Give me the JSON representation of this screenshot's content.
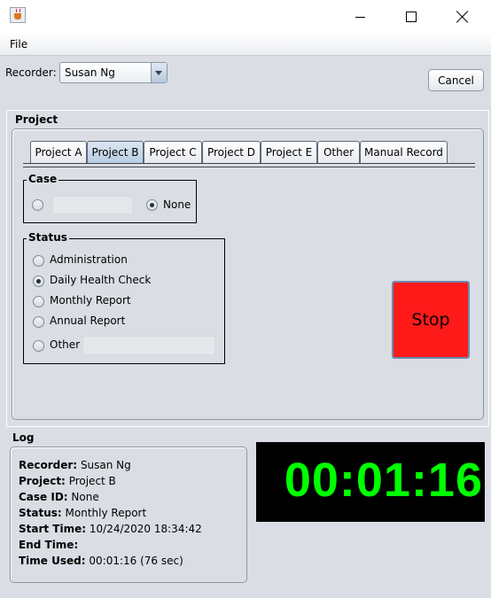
{
  "menu": {
    "file": "File"
  },
  "recorder": {
    "label": "Recorder:",
    "value": "Susan Ng"
  },
  "buttons": {
    "cancel": "Cancel",
    "stop": "Stop"
  },
  "project": {
    "title": "Project",
    "tabs": [
      "Project A",
      "Project B",
      "Project C",
      "Project D",
      "Project E",
      "Other",
      "Manual Record"
    ],
    "selected_tab": "Project B",
    "case": {
      "title": "Case",
      "field_value": "",
      "none_label": "None",
      "selected": "None"
    },
    "status": {
      "title": "Status",
      "options": [
        "Administration",
        "Daily Health Check",
        "Monthly Report",
        "Annual Report",
        "Other"
      ],
      "selected": "Daily Health Check",
      "other_value": ""
    }
  },
  "log": {
    "title": "Log",
    "lines": [
      {
        "label": "Recorder:",
        "value": "Susan Ng"
      },
      {
        "label": "Project:",
        "value": "Project B"
      },
      {
        "label": "Case ID:",
        "value": "None"
      },
      {
        "label": "Status:",
        "value": "Monthly Report"
      },
      {
        "label": "Start Time:",
        "value": "10/24/2020 18:34:42"
      },
      {
        "label": "End Time:",
        "value": ""
      },
      {
        "label": "Time Used:",
        "value": "00:01:16 (76 sec)"
      }
    ]
  },
  "timer": {
    "display": "00:01:16"
  },
  "colors": {
    "stop_button": "#ff1a1a",
    "timer_text": "#00ff00",
    "timer_bg": "#000000",
    "selected_tab": "#c4d6e8"
  },
  "icons": {
    "app": "java-coffee-cup-icon",
    "minimize": "minimize-icon",
    "maximize": "maximize-icon",
    "close": "close-icon",
    "dropdown": "chevron-down-icon"
  }
}
